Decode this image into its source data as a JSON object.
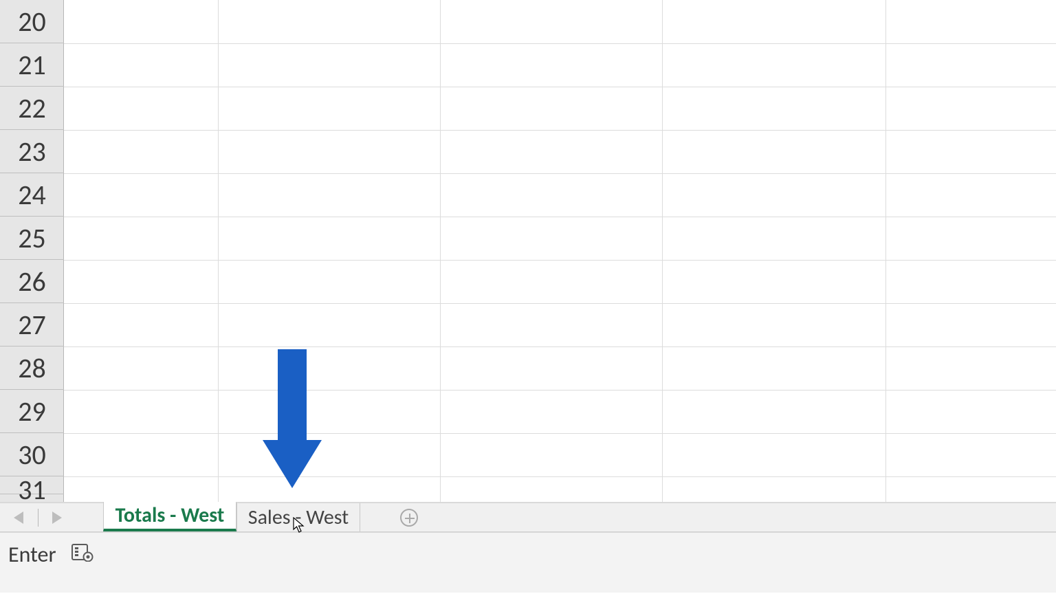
{
  "rows": {
    "start": 20,
    "labels": [
      "20",
      "21",
      "22",
      "23",
      "24",
      "25",
      "26",
      "27",
      "28",
      "29",
      "30",
      "31"
    ]
  },
  "column_gridlines_x": [
    93,
    317,
    640,
    963,
    1288
  ],
  "tabs": {
    "active_label": "Totals - West",
    "inactive_label": "Sales - West"
  },
  "status": {
    "mode": "Enter"
  },
  "icons": {
    "nav_first": "sheet-nav-first",
    "nav_last": "sheet-nav-last",
    "new_sheet": "plus-circle-icon",
    "macro": "macro-record-icon"
  },
  "annotation": {
    "arrow_color": "#1a5fc4"
  }
}
